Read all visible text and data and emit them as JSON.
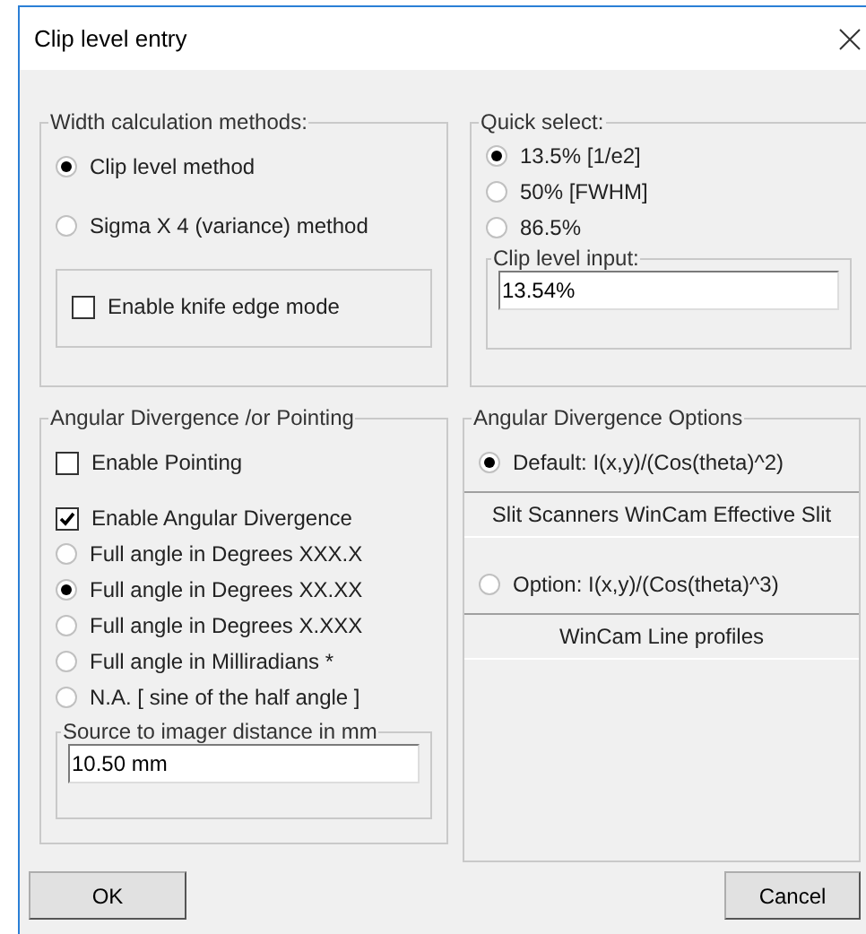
{
  "window": {
    "title": "Clip level entry"
  },
  "width_methods": {
    "title": "Width calculation methods:",
    "options": [
      {
        "label": "Clip level method",
        "selected": true
      },
      {
        "label": "Sigma X 4 (variance) method",
        "selected": false
      }
    ],
    "knife_edge": {
      "label": "Enable knife edge mode",
      "checked": false
    }
  },
  "quick_select": {
    "title": "Quick select:",
    "options": [
      {
        "label": "13.5% [1/e2]",
        "selected": true
      },
      {
        "label": "50% [FWHM]",
        "selected": false
      },
      {
        "label": "86.5%",
        "selected": false
      }
    ],
    "clip_input": {
      "title": "Clip level input:",
      "value": "13.54%"
    }
  },
  "angular": {
    "title": "Angular Divergence /or Pointing",
    "pointing": {
      "label": "Enable Pointing",
      "checked": false
    },
    "divergence": {
      "label": "Enable Angular Divergence",
      "checked": true
    },
    "units": [
      {
        "label": "Full angle in Degrees XXX.X",
        "selected": false
      },
      {
        "label": "Full angle in Degrees XX.XX",
        "selected": true
      },
      {
        "label": "Full angle in Degrees X.XXX",
        "selected": false
      },
      {
        "label": "Full angle in Milliradians  *",
        "selected": false
      },
      {
        "label": "N.A.  [ sine of the half angle ]",
        "selected": false
      }
    ],
    "distance": {
      "title": "Source to imager distance in mm",
      "value": "10.50 mm"
    }
  },
  "options": {
    "title": "Angular Divergence Options",
    "items": [
      {
        "label": "Default: I(x,y)/(Cos(theta)^2)",
        "selected": true,
        "note": "Slit Scanners  WinCam Effective Slit"
      },
      {
        "label": "Option: I(x,y)/(Cos(theta)^3)",
        "selected": false,
        "note": "WinCam Line profiles"
      }
    ]
  },
  "buttons": [
    "OK",
    "Cancel"
  ]
}
